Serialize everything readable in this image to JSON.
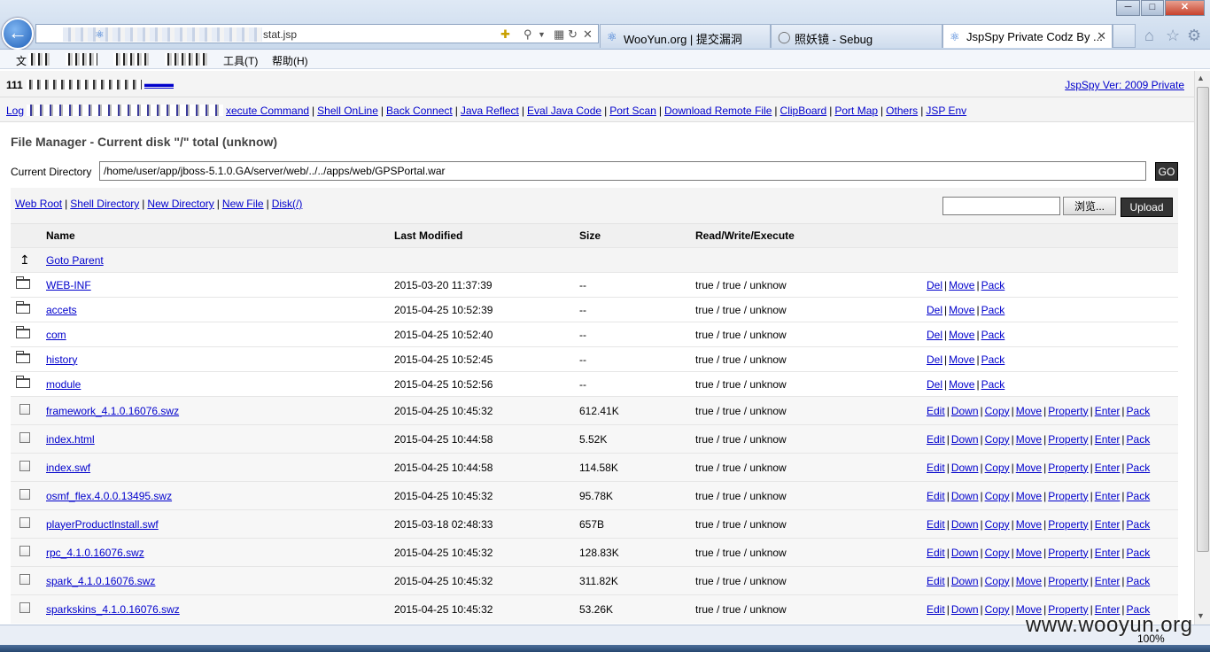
{
  "browser": {
    "address_tail": "stat.jsp",
    "tabs": [
      {
        "label": "WooYun.org | 提交漏洞",
        "icon": "ie-icon"
      },
      {
        "label": "照妖镜 - Sebug",
        "icon": "loading-icon"
      },
      {
        "label": "JspSpy Private Codz By ...",
        "icon": "ie-icon"
      }
    ],
    "menu": {
      "tools": "工具(T)",
      "help": "帮助(H)",
      "file": "文"
    }
  },
  "page": {
    "host_prefix": "111",
    "version_link": "JspSpy Ver: 2009 Private",
    "nav_first": "Log",
    "nav_links": [
      "xecute Command",
      "Shell OnLine",
      "Back Connect",
      "Java Reflect",
      "Eval Java Code",
      "Port Scan",
      "Download Remote File",
      "ClipBoard",
      "Port Map",
      "Others",
      "JSP Env"
    ],
    "title": "File Manager - Current disk \"/\" total (unknow)",
    "current_dir_label": "Current Directory",
    "current_dir_value": "/home/user/app/jboss-5.1.0.GA/server/web/../../apps/web/GPSPortal.war",
    "go_label": "GO",
    "tool_links": [
      "Web Root",
      "Shell Directory",
      "New Directory",
      "New File",
      "Disk(/)"
    ],
    "browse_label": "浏览...",
    "upload_label": "Upload",
    "columns": {
      "name": "Name",
      "modified": "Last Modified",
      "size": "Size",
      "perm": "Read/Write/Execute"
    },
    "parent_label": "Goto Parent",
    "dirs": [
      {
        "name": "WEB-INF",
        "modified": "2015-03-20 11:37:39",
        "size": "--",
        "perm": "true / true / unknow"
      },
      {
        "name": "accets",
        "modified": "2015-04-25 10:52:39",
        "size": "--",
        "perm": "true / true / unknow"
      },
      {
        "name": "com",
        "modified": "2015-04-25 10:52:40",
        "size": "--",
        "perm": "true / true / unknow"
      },
      {
        "name": "history",
        "modified": "2015-04-25 10:52:45",
        "size": "--",
        "perm": "true / true / unknow"
      },
      {
        "name": "module",
        "modified": "2015-04-25 10:52:56",
        "size": "--",
        "perm": "true / true / unknow"
      }
    ],
    "dir_actions": [
      "Del",
      "Move",
      "Pack"
    ],
    "files": [
      {
        "name": "framework_4.1.0.16076.swz",
        "modified": "2015-04-25 10:45:32",
        "size": "612.41K",
        "perm": "true / true / unknow"
      },
      {
        "name": "index.html",
        "modified": "2015-04-25 10:44:58",
        "size": "5.52K",
        "perm": "true / true / unknow"
      },
      {
        "name": "index.swf",
        "modified": "2015-04-25 10:44:58",
        "size": "114.58K",
        "perm": "true / true / unknow"
      },
      {
        "name": "osmf_flex.4.0.0.13495.swz",
        "modified": "2015-04-25 10:45:32",
        "size": "95.78K",
        "perm": "true / true / unknow"
      },
      {
        "name": "playerProductInstall.swf",
        "modified": "2015-03-18 02:48:33",
        "size": "657B",
        "perm": "true / true / unknow"
      },
      {
        "name": "rpc_4.1.0.16076.swz",
        "modified": "2015-04-25 10:45:32",
        "size": "128.83K",
        "perm": "true / true / unknow"
      },
      {
        "name": "spark_4.1.0.16076.swz",
        "modified": "2015-04-25 10:45:32",
        "size": "311.82K",
        "perm": "true / true / unknow"
      },
      {
        "name": "sparkskins_4.1.0.16076.swz",
        "modified": "2015-04-25 10:45:32",
        "size": "53.26K",
        "perm": "true / true / unknow"
      }
    ],
    "file_actions": [
      "Edit",
      "Down",
      "Copy",
      "Move",
      "Property",
      "Enter",
      "Pack"
    ]
  },
  "status": {
    "zoom": "100%",
    "watermark": "www.wooyun.org"
  }
}
